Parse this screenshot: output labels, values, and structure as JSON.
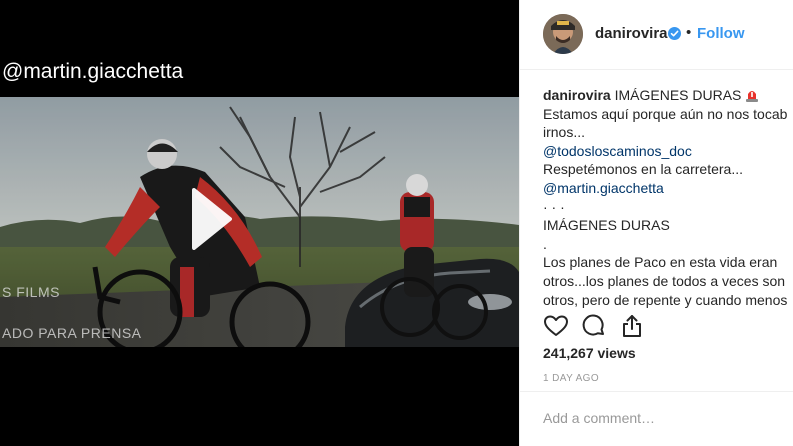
{
  "video": {
    "overlay_handle": "@martin.giacchetta",
    "watermark_line1": "S FILMS",
    "watermark_line2": "ADO PARA PRENSA",
    "play_icon": "play-icon"
  },
  "header": {
    "username": "danirovira",
    "verified_icon": "verified-badge-icon",
    "separator": "•",
    "follow_label": "Follow"
  },
  "caption": {
    "author": "danirovira",
    "line1_text": "IMÁGENES DURAS",
    "line2": "Estamos aquí porque aún no nos tocab",
    "line3": "irnos...",
    "mention1": "@todosloscaminos_doc",
    "line5": "Respetémonos en la carretera...",
    "mention2": "@martin.giacchetta",
    "line7": "· · ·",
    "line8": "IMÁGENES DURAS",
    "line9": ".",
    "line10": "Los planes de Paco en esta vida eran",
    "line11": "otros...los planes de todos a veces son",
    "line12": "otros, pero de repente y cuando menos"
  },
  "actions": {
    "like_icon": "heart-icon",
    "comment_icon": "comment-icon",
    "share_icon": "share-icon"
  },
  "stats": {
    "views": "241,267 views",
    "time_ago": "1 DAY AGO"
  },
  "comment": {
    "placeholder": "Add a comment…"
  },
  "colors": {
    "link": "#003569",
    "follow": "#3897f0",
    "verified": "#3897f0",
    "text": "#262626",
    "muted": "#999999"
  }
}
